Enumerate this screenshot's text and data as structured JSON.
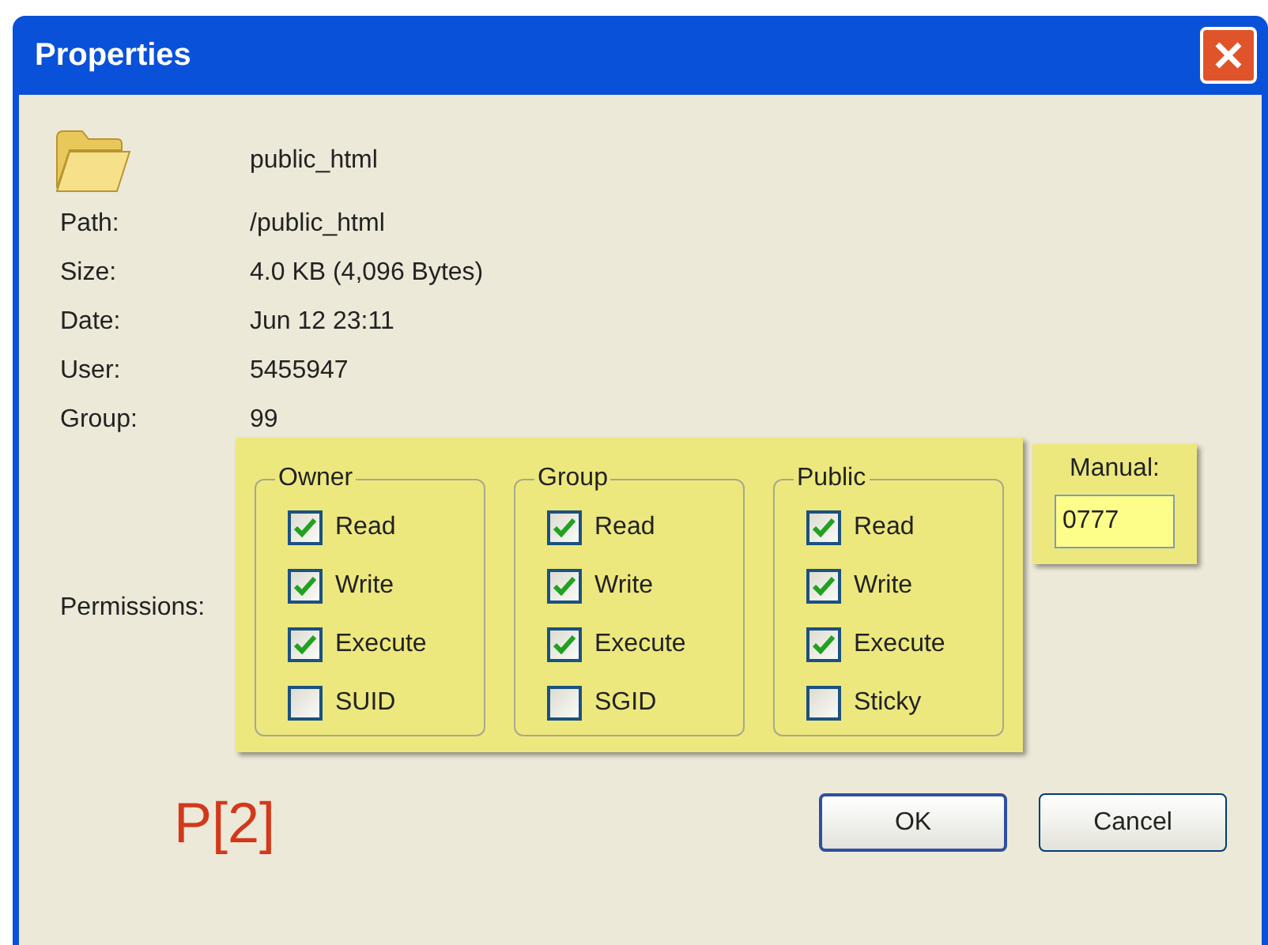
{
  "window": {
    "title": "Properties"
  },
  "name": "public_html",
  "fields": [
    {
      "label": "Path:",
      "value": "/public_html"
    },
    {
      "label": "Size:",
      "value": "4.0 KB  (4,096 Bytes)"
    },
    {
      "label": "Date:",
      "value": "Jun  12 23:11"
    },
    {
      "label": "User:",
      "value": "5455947"
    },
    {
      "label": "Group:",
      "value": "99"
    }
  ],
  "permissions": {
    "label": "Permissions:",
    "groups": [
      {
        "title": "Owner",
        "items": [
          {
            "label": "Read",
            "checked": true
          },
          {
            "label": "Write",
            "checked": true
          },
          {
            "label": "Execute",
            "checked": true
          },
          {
            "label": "SUID",
            "checked": false
          }
        ]
      },
      {
        "title": "Group",
        "items": [
          {
            "label": "Read",
            "checked": true
          },
          {
            "label": "Write",
            "checked": true
          },
          {
            "label": "Execute",
            "checked": true
          },
          {
            "label": "SGID",
            "checked": false
          }
        ]
      },
      {
        "title": "Public",
        "items": [
          {
            "label": "Read",
            "checked": true
          },
          {
            "label": "Write",
            "checked": true
          },
          {
            "label": "Execute",
            "checked": true
          },
          {
            "label": "Sticky",
            "checked": false
          }
        ]
      }
    ],
    "manual": {
      "label": "Manual:",
      "value": "0777"
    }
  },
  "annotation": "P[2]",
  "buttons": [
    "OK",
    "Cancel"
  ]
}
